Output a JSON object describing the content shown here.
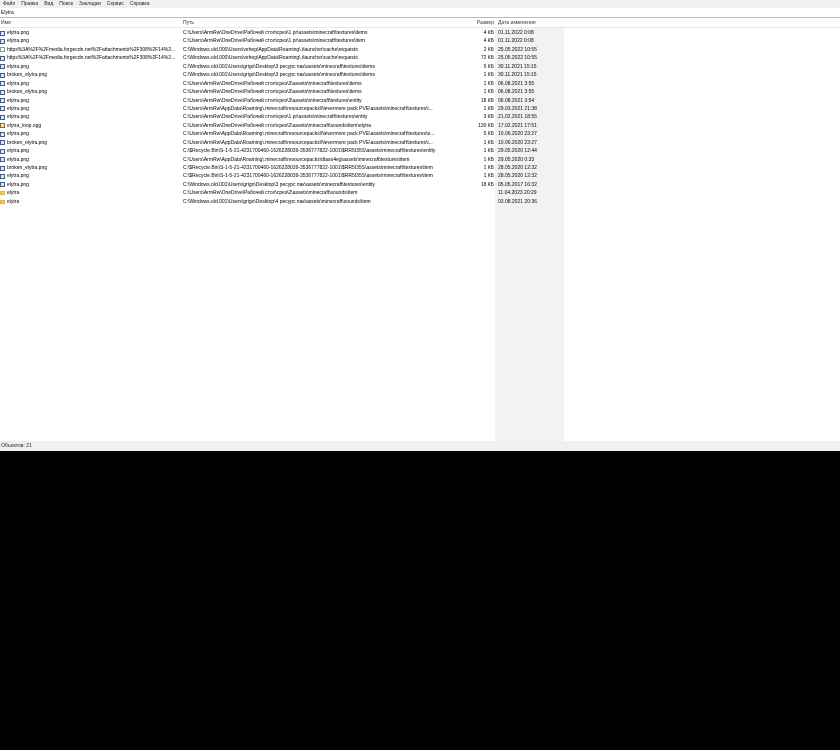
{
  "menu": [
    "Файл",
    "Правка",
    "Вид",
    "Поиск",
    "Закладки",
    "Сервис",
    "Справка"
  ],
  "search": {
    "value": "Elytra"
  },
  "columns": {
    "name": "Имя",
    "path": "Путь",
    "size": "Размер",
    "date": "Дата изменения"
  },
  "rows": [
    {
      "icon": "png",
      "name": "elytra.png",
      "path": "C:\\Users\\ArmRw\\OneDrive\\Рабочий стол\\срез\\1 pr\\assets\\minecraft\\textures\\items",
      "size": "4 КБ",
      "date": "01.11.2022 0:08"
    },
    {
      "icon": "png",
      "name": "elytra.png",
      "path": "C:\\Users\\ArmRw\\OneDrive\\Рабочий стол\\срез\\1 pr\\assets\\minecraft\\textures\\item",
      "size": "4 КБ",
      "date": "01.11.2022 0:08"
    },
    {
      "icon": "file",
      "name": "https%3A%2F%2Fmedia.forgecdn.net%2Fattachments%2F308%2F14%2...",
      "path": "C:\\Windows.old.000\\Users\\veheg\\AppData\\Roaming\\.tlauncher\\cache\\requests",
      "size": "2 КБ",
      "date": "25.05.2022 10:55"
    },
    {
      "icon": "png",
      "name": "https%3A%2F%2Fmedia.forgecdn.net%2Fattachments%2F308%2F14%2...",
      "path": "C:\\Windows.old.000\\Users\\veheg\\AppData\\Roaming\\.tlauncher\\cache\\requests",
      "size": "72 КБ",
      "date": "25.05.2022 10:55"
    },
    {
      "icon": "png",
      "name": "elytra.png",
      "path": "C:\\Windows.old.001\\Users\\grigo\\Desktop\\3 ресурс пак\\assets\\minecraft\\textures\\items",
      "size": "5 КБ",
      "date": "30.11.2021 15:15"
    },
    {
      "icon": "png",
      "name": "broken_elytra.png",
      "path": "C:\\Windows.old.001\\Users\\grigo\\Desktop\\3 ресурс пак\\assets\\minecraft\\textures\\items",
      "size": "1 КБ",
      "date": "30.11.2021 15:15"
    },
    {
      "icon": "png",
      "name": "elytra.png",
      "path": "C:\\Users\\ArmRw\\OneDrive\\Рабочий стол\\срез\\3\\assets\\minecraft\\textures\\items",
      "size": "1 КБ",
      "date": "06.08.2021 3:55"
    },
    {
      "icon": "png",
      "name": "broken_elytra.png",
      "path": "C:\\Users\\ArmRw\\OneDrive\\Рабочий стол\\срез\\3\\assets\\minecraft\\textures\\items",
      "size": "1 КБ",
      "date": "06.08.2021 3:55"
    },
    {
      "icon": "png",
      "name": "elytra.png",
      "path": "C:\\Users\\ArmRw\\OneDrive\\Рабочий стол\\срез\\3\\assets\\minecraft\\textures\\entity",
      "size": "18 КБ",
      "date": "06.08.2021 3:54"
    },
    {
      "icon": "png",
      "name": "elytra.png",
      "path": "C:\\Users\\ArmRw\\AppData\\Roaming\\.minecraft\\resourcepacks\\Nevermore pack PVE\\assets\\minecraft\\textures\\i...",
      "size": "1 КБ",
      "date": "29.03.2021 21:38"
    },
    {
      "icon": "png",
      "name": "elytra.png",
      "path": "C:\\Users\\ArmRw\\OneDrive\\Рабочий стол\\срез\\1 pr\\assets\\minecraft\\textures\\entity",
      "size": "3 КБ",
      "date": "21.02.2021 18:55"
    },
    {
      "icon": "ogg",
      "name": "elytra_loop.ogg",
      "path": "C:\\Users\\ArmRw\\OneDrive\\Рабочий стол\\срез\\2\\assets\\minecraft\\sounds\\item\\elytra",
      "size": "130 КБ",
      "date": "17.02.2021 17:51"
    },
    {
      "icon": "png",
      "name": "elytra.png",
      "path": "C:\\Users\\ArmRw\\AppData\\Roaming\\.minecraft\\resourcepacks\\Nevermore pack PVE\\assets\\minecraft\\textures\\e...",
      "size": "5 КБ",
      "date": "10.06.2020 23:27"
    },
    {
      "icon": "png",
      "name": "broken_elytra.png",
      "path": "C:\\Users\\ArmRw\\AppData\\Roaming\\.minecraft\\resourcepacks\\Nevermore pack PVE\\assets\\minecraft\\textures\\i...",
      "size": "1 КБ",
      "date": "10.06.2020 23:27"
    },
    {
      "icon": "png",
      "name": "elytra.png",
      "path": "C:\\$Recycle.Bin\\S-1-5-21-4231700460-1626228039-3536777822-1001\\$RR5I35S\\assets\\minecraft\\textures\\entity",
      "size": "1 КБ",
      "date": "29.05.2020 12:44"
    },
    {
      "icon": "png",
      "name": "elytra.png",
      "path": "C:\\Users\\ArmRw\\AppData\\Roaming\\.minecraft\\resourcepacks\\dtaso4eg\\assets\\minecraft\\textures\\item",
      "size": "1 КБ",
      "date": "29.05.2020 0:33"
    },
    {
      "icon": "png",
      "name": "broken_elytra.png",
      "path": "C:\\$Recycle.Bin\\S-1-5-21-4231700460-1626228039-3536777822-1001\\$RR5I35S\\assets\\minecraft\\textures\\item",
      "size": "1 КБ",
      "date": "28.05.2020 12:32"
    },
    {
      "icon": "png",
      "name": "elytra.png",
      "path": "C:\\$Recycle.Bin\\S-1-5-21-4231700460-1626228039-3536777822-1001\\$RR5I35S\\assets\\minecraft\\textures\\item",
      "size": "1 КБ",
      "date": "28.05.2020 12:32"
    },
    {
      "icon": "png",
      "name": "elytra.png",
      "path": "C:\\Windows.old.001\\Users\\grigo\\Desktop\\3 ресурс пак\\assets\\minecraft\\textures\\entity",
      "size": "18 КБ",
      "date": "05.05.2017 16:32"
    },
    {
      "icon": "folder",
      "name": "elytra",
      "path": "C:\\Users\\ArmRw\\OneDrive\\Рабочий стол\\срез\\2\\assets\\minecraft\\sounds\\item",
      "size": "",
      "date": "11.04.2023 20:29"
    },
    {
      "icon": "folder",
      "name": "elytra",
      "path": "C:\\Windows.old.001\\Users\\grigo\\Desktop\\4 ресурс пак\\assets\\minecraft\\sounds\\item",
      "size": "",
      "date": "03.08.2021 20:36"
    }
  ],
  "status": {
    "text": "Объектов: 21"
  }
}
